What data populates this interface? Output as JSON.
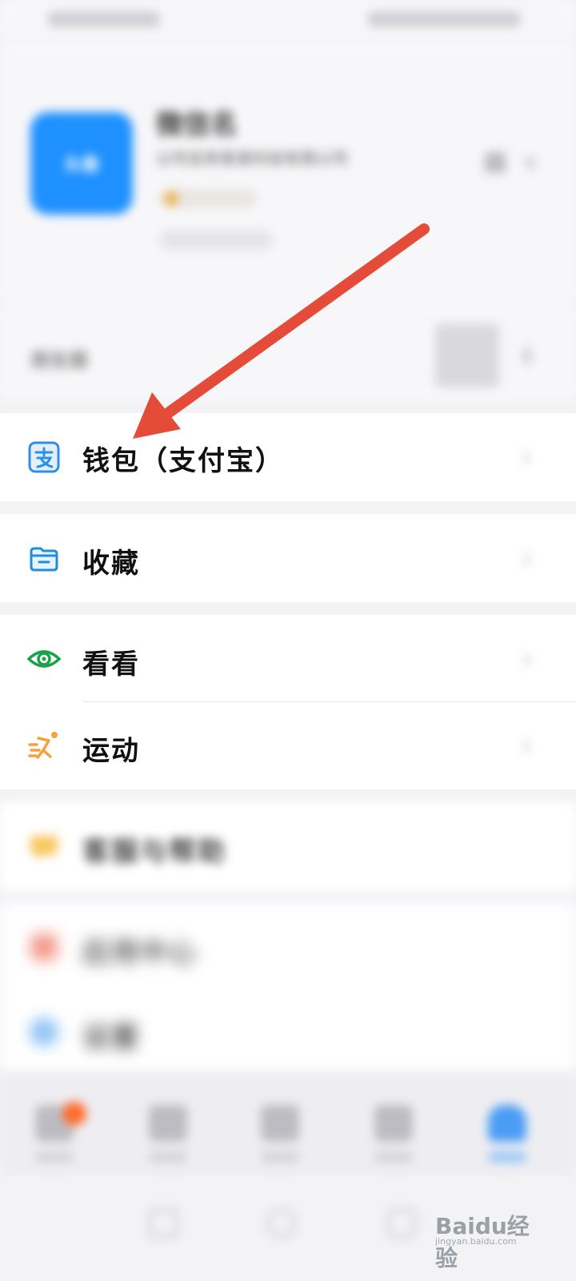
{
  "profile": {
    "name": "微信名",
    "company": "公司名称某某科技有限公司",
    "avatar_text": "头像"
  },
  "moments": {
    "label": "朋友圈"
  },
  "menu": {
    "wallet": "钱包（支付宝）",
    "favorites": "收藏",
    "watch": "看看",
    "sports": "运动",
    "support": "客服与帮助",
    "app_center": "应用中心",
    "settings": "设置"
  },
  "watermark": {
    "brand": "Baidu经验",
    "url": "jingyan.baidu.com"
  },
  "colors": {
    "wallet_icon": "#2f8fe6",
    "favorites_icon": "#1e8fd8",
    "watch_icon": "#1aa34a",
    "sports_icon": "#f5a23a",
    "arrow": "#e44b39"
  }
}
